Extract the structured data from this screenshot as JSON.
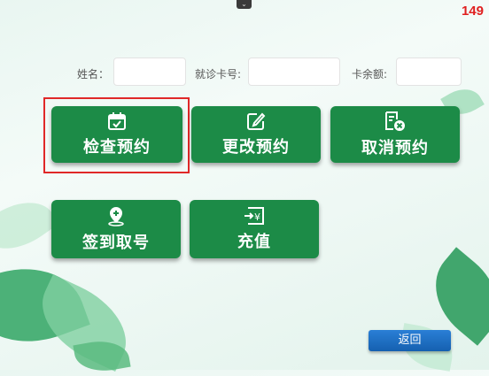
{
  "top_handle_icon": "chevron-down-icon",
  "counter": "149",
  "form": {
    "name_label": "姓名：",
    "card_label": "就诊卡号:",
    "balance_label": "卡余额:",
    "name_value": "",
    "card_value": "",
    "balance_value": ""
  },
  "buttons": {
    "exam_booking": {
      "label": "检查预约",
      "icon": "calendar-check-icon"
    },
    "change_booking": {
      "label": "更改预约",
      "icon": "edit-icon"
    },
    "cancel_booking": {
      "label": "取消预约",
      "icon": "document-cancel-icon"
    },
    "checkin": {
      "label": "签到取号",
      "icon": "location-add-icon"
    },
    "recharge": {
      "label": "充值",
      "icon": "yuan-login-icon"
    }
  },
  "back_button": "返回",
  "colors": {
    "button_green": "#1c8b47",
    "highlight_red": "#e02828",
    "back_blue": "#1f72c8"
  }
}
